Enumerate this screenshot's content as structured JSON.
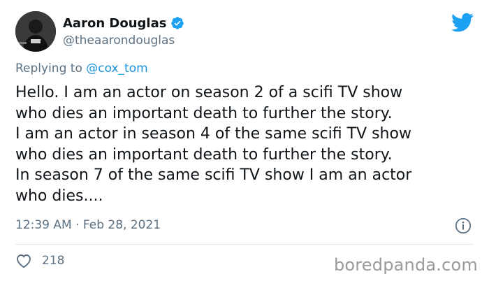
{
  "author": {
    "name": "Aaron Douglas",
    "handle": "@theaarondouglas",
    "verified": true
  },
  "reply": {
    "prefix": "Replying to",
    "mention": "@cox_tom"
  },
  "tweet": {
    "lines": [
      "Hello. I am an actor on season 2 of a scifi TV show",
      "who dies an important death to further the story.",
      "I am an actor in season 4 of the same scifi TV show",
      "who dies an important death to further the story.",
      "In season 7 of the same scifi TV show I am an actor",
      "who dies...."
    ]
  },
  "meta": {
    "timestamp": "12:39 AM · Feb 28, 2021"
  },
  "engagement": {
    "likes": "218"
  },
  "watermark": "boredpanda.com",
  "colors": {
    "accent": "#1da1f2",
    "text": "#0f1419",
    "muted": "#5b7083"
  },
  "icons": {
    "verified": "verified-badge-icon",
    "brand": "twitter-bird-icon",
    "info": "info-icon",
    "like": "heart-icon"
  }
}
